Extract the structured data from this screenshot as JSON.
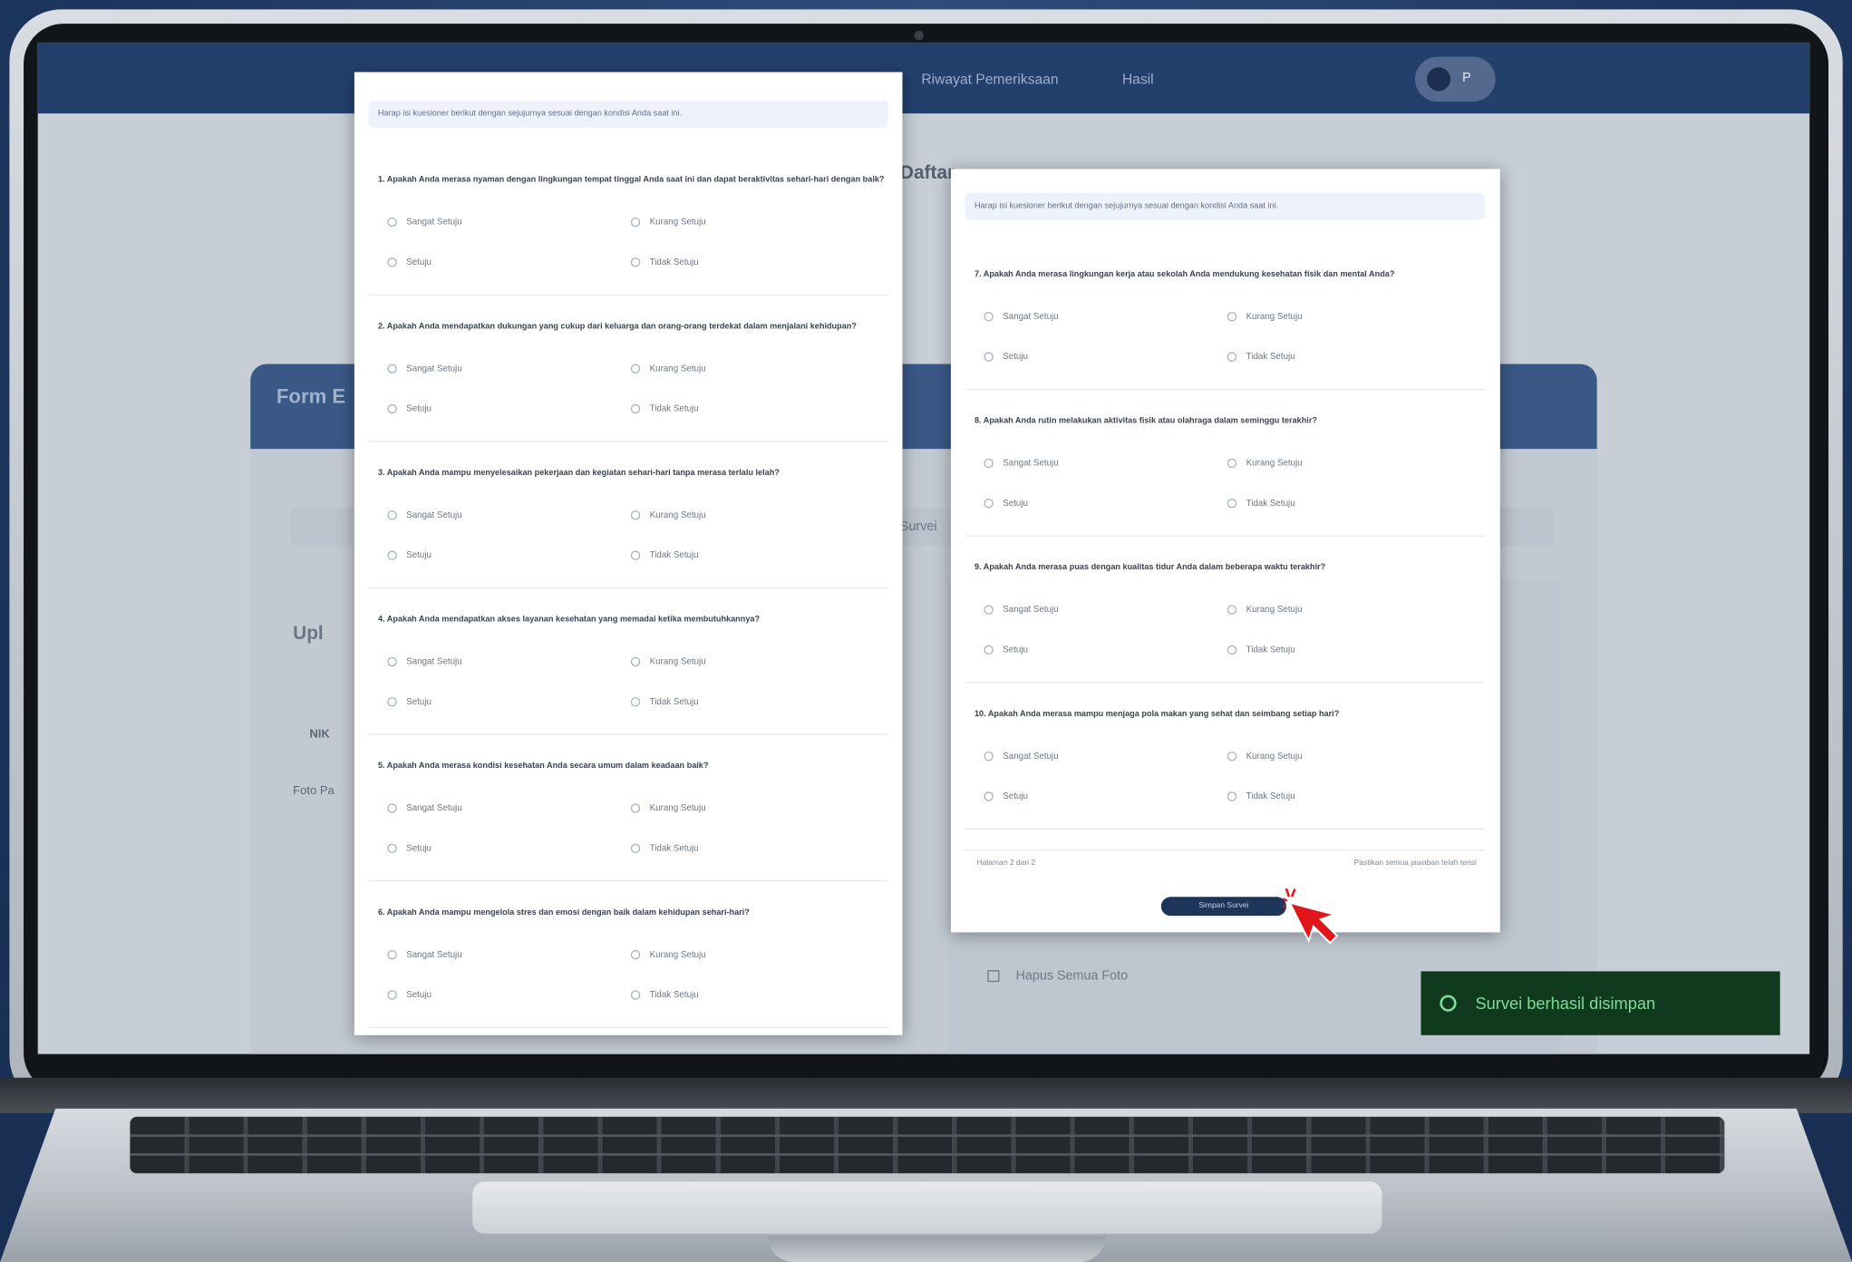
{
  "app": {
    "nav_links": [
      "Riwayat Pemeriksaan",
      "Hasil"
    ],
    "user_initial": "P",
    "page_title": "Daftar",
    "form_title": "Form E",
    "tab_label": "Survei",
    "upload_label": "Upl",
    "field_label": "NIK",
    "photo_label": "Foto Pa",
    "clear_label": "Hapus Semua Foto"
  },
  "sheet_left": {
    "notice": "Harap isi kuesioner berikut dengan sejujurnya sesuai dengan kondisi Anda saat ini.",
    "questions": [
      {
        "text": "1. Apakah Anda merasa nyaman dengan lingkungan tempat tinggal Anda saat ini dan dapat beraktivitas sehari-hari dengan baik?",
        "options": [
          "Sangat Setuju",
          "Kurang Setuju",
          "Setuju",
          "Tidak Setuju"
        ]
      },
      {
        "text": "2. Apakah Anda mendapatkan dukungan yang cukup dari keluarga dan orang-orang terdekat dalam menjalani kehidupan?",
        "options": [
          "Sangat Setuju",
          "Kurang Setuju",
          "Setuju",
          "Tidak Setuju"
        ]
      },
      {
        "text": "3. Apakah Anda mampu menyelesaikan pekerjaan dan kegiatan sehari-hari tanpa merasa terlalu lelah?",
        "options": [
          "Sangat Setuju",
          "Kurang Setuju",
          "Setuju",
          "Tidak Setuju"
        ]
      },
      {
        "text": "4. Apakah Anda mendapatkan akses layanan kesehatan yang memadai ketika membutuhkannya?",
        "options": [
          "Sangat Setuju",
          "Kurang Setuju",
          "Setuju",
          "Tidak Setuju"
        ]
      },
      {
        "text": "5. Apakah Anda merasa kondisi kesehatan Anda secara umum dalam keadaan baik?",
        "options": [
          "Sangat Setuju",
          "Kurang Setuju",
          "Setuju",
          "Tidak Setuju"
        ]
      },
      {
        "text": "6. Apakah Anda mampu mengelola stres dan emosi dengan baik dalam kehidupan sehari-hari?",
        "options": [
          "Sangat Setuju",
          "Kurang Setuju",
          "Setuju",
          "Tidak Setuju"
        ]
      }
    ]
  },
  "sheet_right": {
    "notice": "Harap isi kuesioner berikut dengan sejujurnya sesuai dengan kondisi Anda saat ini.",
    "questions": [
      {
        "text": "7. Apakah Anda merasa lingkungan kerja atau sekolah Anda mendukung kesehatan fisik dan mental Anda?",
        "options": [
          "Sangat Setuju",
          "Kurang Setuju",
          "Setuju",
          "Tidak Setuju"
        ]
      },
      {
        "text": "8. Apakah Anda rutin melakukan aktivitas fisik atau olahraga dalam seminggu terakhir?",
        "options": [
          "Sangat Setuju",
          "Kurang Setuju",
          "Setuju",
          "Tidak Setuju"
        ]
      },
      {
        "text": "9. Apakah Anda merasa puas dengan kualitas tidur Anda dalam beberapa waktu terakhir?",
        "options": [
          "Sangat Setuju",
          "Kurang Setuju",
          "Setuju",
          "Tidak Setuju"
        ]
      },
      {
        "text": "10. Apakah Anda merasa mampu menjaga pola makan yang sehat dan seimbang setiap hari?",
        "options": [
          "Sangat Setuju",
          "Kurang Setuju",
          "Setuju",
          "Tidak Setuju"
        ]
      }
    ],
    "pager_left": "Halaman 2 dari 2",
    "pager_right": "Pastikan semua jawaban telah terisi",
    "save_label": "Simpan Survei"
  },
  "toast": {
    "message": "Survei berhasil disimpan"
  },
  "colors": {
    "navbar": "#23406d",
    "toast_bg": "#0f3a1e",
    "toast_text": "#7fdc97",
    "cursor": "#e0161b"
  }
}
